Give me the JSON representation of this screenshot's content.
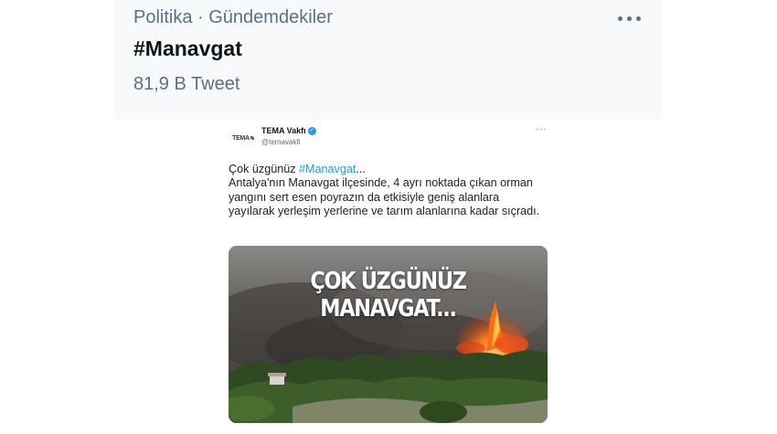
{
  "trend": {
    "context": "Politika · Gündemdekiler",
    "title": "#Manavgat",
    "count": "81,9 B Tweet"
  },
  "tweet": {
    "author": {
      "name": "TEMA Vakfı",
      "handle": "@temavakfi",
      "avatar_text": "TEMA",
      "verified": true
    },
    "text": {
      "line1_prefix": "Çok üzgünüz ",
      "hashtag": "#Manavgat",
      "line1_suffix": "...",
      "body": "Antalya'nın Manavgat ilçesinde, 4 ayrı noktada çıkan orman yangını sert esen poyrazın da etkisiyle geniş alanlara yayılarak yerleşim yerlerine ve tarım alanlarına kadar sıçradı."
    },
    "media": {
      "caption": "ÇOK ÜZGÜNÜZ MANAVGAT..."
    }
  },
  "icons": {
    "more": "more-horizontal-icon",
    "verified": "verified-badge-icon"
  },
  "colors": {
    "background": "#ffffff",
    "trend_card": "#f7f9fa",
    "secondary_text": "#5b7083",
    "primary_text": "#0f1419",
    "link": "#1d9bf0"
  }
}
